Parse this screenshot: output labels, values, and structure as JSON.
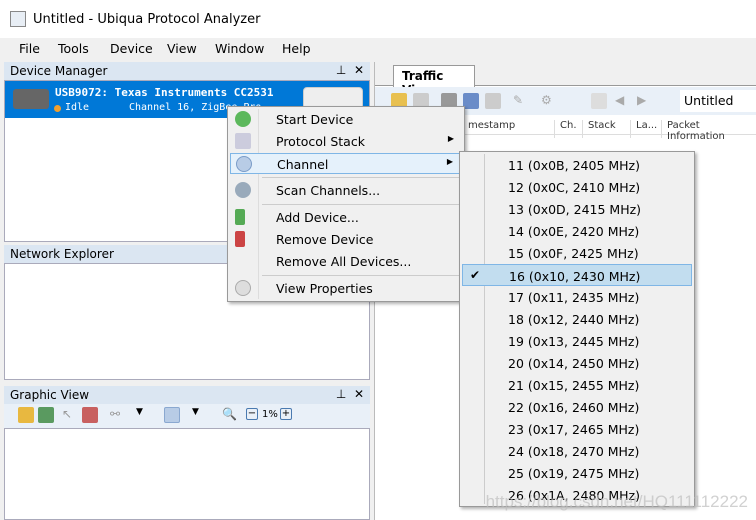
{
  "window": {
    "title": "Untitled - Ubiqua Protocol Analyzer"
  },
  "menubar": [
    "File",
    "Tools",
    "Device",
    "View",
    "Window",
    "Help"
  ],
  "device_manager": {
    "title": "Device Manager",
    "device": {
      "name": "USB9072: Texas Instruments CC2531",
      "status": "Idle",
      "info": "Channel 16, ZigBee Pro"
    }
  },
  "network_explorer": {
    "title": "Network Explorer"
  },
  "graphic_view": {
    "title": "Graphic View",
    "zoom": "1%"
  },
  "traffic_view": {
    "tab": "Traffic View",
    "session": "Untitled",
    "columns": [
      "mestamp",
      "Ch.",
      "Stack",
      "La...",
      "Packet Information"
    ]
  },
  "context_menu": {
    "items": [
      "Start Device",
      "Protocol Stack",
      "Channel",
      "Scan Channels...",
      "Add Device...",
      "Remove Device",
      "Remove All Devices...",
      "View Properties"
    ]
  },
  "channel_menu": {
    "selected": "16 (0x10, 2430 MHz)",
    "items": [
      "11 (0x0B, 2405 MHz)",
      "12 (0x0C, 2410 MHz)",
      "13 (0x0D, 2415 MHz)",
      "14 (0x0E, 2420 MHz)",
      "15 (0x0F, 2425 MHz)",
      "16 (0x10, 2430 MHz)",
      "17 (0x11, 2435 MHz)",
      "18 (0x12, 2440 MHz)",
      "19 (0x13, 2445 MHz)",
      "20 (0x14, 2450 MHz)",
      "21 (0x15, 2455 MHz)",
      "22 (0x16, 2460 MHz)",
      "23 (0x17, 2465 MHz)",
      "24 (0x18, 2470 MHz)",
      "25 (0x19, 2475 MHz)",
      "26 (0x1A, 2480 MHz)"
    ]
  },
  "watermark": "https://blog.csdn.net/HQ111112222",
  "colors": {
    "selection": "#0078d7",
    "panel_header": "#dbe6f2",
    "menu_highlight": "#c2ddef"
  }
}
